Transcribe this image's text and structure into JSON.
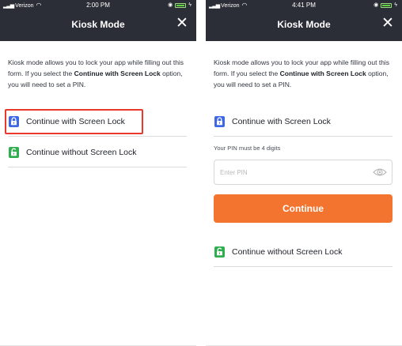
{
  "colors": {
    "header_bg": "#2b2e36",
    "lock_blue": "#3f68e6",
    "unlock_green": "#2fae4f",
    "continue_orange": "#f2742e",
    "highlight_red": "#e8392c"
  },
  "left_screen": {
    "status_bar": {
      "carrier": "Verizon",
      "time": "2:00 PM"
    },
    "header": {
      "title": "Kiosk Mode",
      "close_icon": "close-icon"
    },
    "intro": {
      "part1": "Kiosk mode allows you to lock your app while filling out this form. If you select the ",
      "bold": "Continue with Screen Lock",
      "part2": " option, you will need to set a PIN."
    },
    "options": [
      {
        "label": "Continue with Screen Lock",
        "icon": "lock-icon"
      },
      {
        "label": "Continue without Screen Lock",
        "icon": "unlock-icon"
      }
    ]
  },
  "right_screen": {
    "status_bar": {
      "carrier": "Verizon",
      "time": "4:41 PM"
    },
    "header": {
      "title": "Kiosk Mode",
      "close_icon": "close-icon"
    },
    "intro": {
      "part1": "Kiosk mode allows you to lock your app while filling out this form. If you select the ",
      "bold": "Continue with Screen Lock",
      "part2": " option, you will need to set a PIN."
    },
    "lock_option": {
      "label": "Continue with Screen Lock",
      "icon": "lock-icon"
    },
    "pin": {
      "label": "Your PIN must be 4 digits",
      "placeholder": "Enter PIN",
      "value": ""
    },
    "continue_button": "Continue",
    "unlock_option": {
      "label": "Continue without Screen Lock",
      "icon": "unlock-icon"
    }
  }
}
